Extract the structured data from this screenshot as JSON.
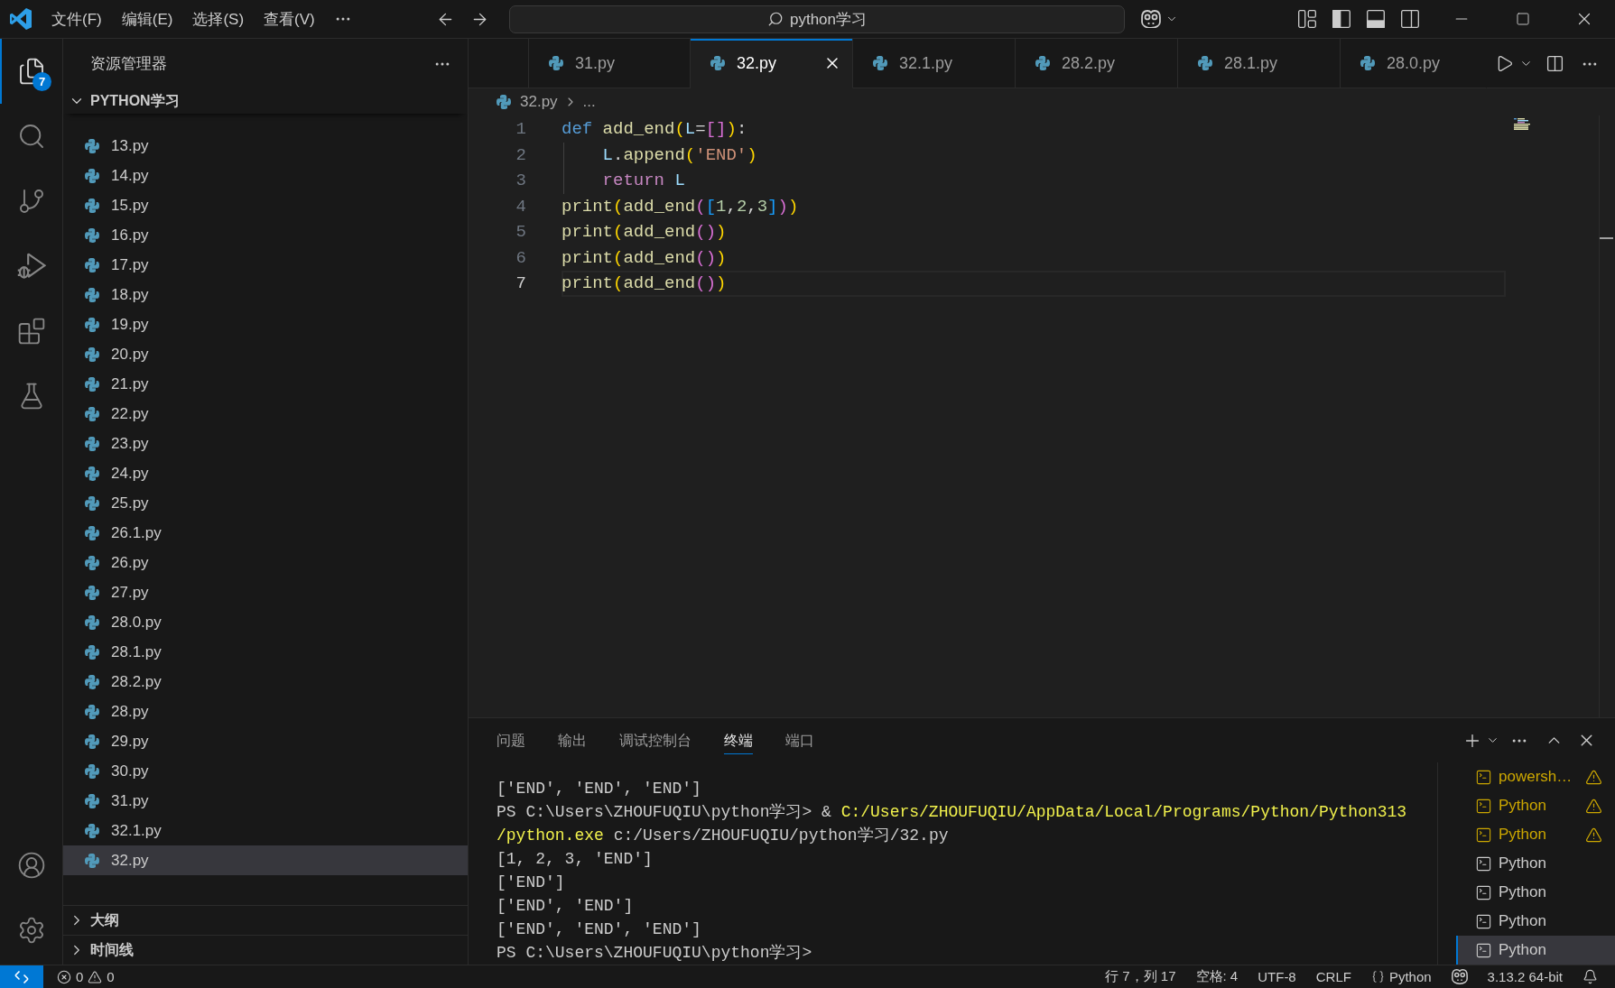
{
  "title_bar": {
    "menus": [
      "文件(F)",
      "编辑(E)",
      "选择(S)",
      "查看(V)"
    ],
    "command_center": {
      "label": "python学习"
    }
  },
  "activity_bar": {
    "items": [
      {
        "kind": "explorer",
        "selected": true,
        "badge": "7"
      },
      {
        "kind": "search",
        "selected": false
      },
      {
        "kind": "source-control",
        "selected": false
      },
      {
        "kind": "run-debug",
        "selected": false
      },
      {
        "kind": "extensions",
        "selected": false
      },
      {
        "kind": "testing",
        "selected": false
      }
    ],
    "bottom": [
      {
        "kind": "account"
      },
      {
        "kind": "settings"
      }
    ]
  },
  "sidebar": {
    "title": "资源管理器",
    "folder": {
      "name": "PYTHON学习",
      "expanded": true,
      "files": [
        {
          "name": "13.py",
          "selected": false
        },
        {
          "name": "14.py",
          "selected": false
        },
        {
          "name": "15.py",
          "selected": false
        },
        {
          "name": "16.py",
          "selected": false
        },
        {
          "name": "17.py",
          "selected": false
        },
        {
          "name": "18.py",
          "selected": false
        },
        {
          "name": "19.py",
          "selected": false
        },
        {
          "name": "20.py",
          "selected": false
        },
        {
          "name": "21.py",
          "selected": false
        },
        {
          "name": "22.py",
          "selected": false
        },
        {
          "name": "23.py",
          "selected": false
        },
        {
          "name": "24.py",
          "selected": false
        },
        {
          "name": "25.py",
          "selected": false
        },
        {
          "name": "26.1.py",
          "selected": false
        },
        {
          "name": "26.py",
          "selected": false
        },
        {
          "name": "27.py",
          "selected": false
        },
        {
          "name": "28.0.py",
          "selected": false
        },
        {
          "name": "28.1.py",
          "selected": false
        },
        {
          "name": "28.2.py",
          "selected": false
        },
        {
          "name": "28.py",
          "selected": false
        },
        {
          "name": "29.py",
          "selected": false
        },
        {
          "name": "30.py",
          "selected": false
        },
        {
          "name": "31.py",
          "selected": false
        },
        {
          "name": "32.1.py",
          "selected": false
        },
        {
          "name": "32.py",
          "selected": true
        }
      ]
    },
    "sections": [
      {
        "name": "大纲",
        "expanded": false
      },
      {
        "name": "时间线",
        "expanded": false
      }
    ]
  },
  "editor": {
    "tabs": [
      {
        "label": "31.py",
        "selected": false
      },
      {
        "label": "32.py",
        "selected": true
      },
      {
        "label": "32.1.py",
        "selected": false
      },
      {
        "label": "28.2.py",
        "selected": false
      },
      {
        "label": "28.1.py",
        "selected": false
      },
      {
        "label": "28.0.py",
        "selected": false
      }
    ],
    "breadcrumb": [
      "32.py",
      "..."
    ],
    "lines": [
      {
        "number": "1",
        "current": false,
        "tokens": [
          {
            "text": "def ",
            "kind": "keyword"
          },
          {
            "text": "add_end",
            "kind": "function"
          },
          {
            "text": "(",
            "kind": "bracket-1"
          },
          {
            "text": "L",
            "kind": "variable"
          },
          {
            "text": "=",
            "kind": "operator"
          },
          {
            "text": "[]",
            "kind": "bracket-2"
          },
          {
            "text": ")",
            "kind": "bracket-1"
          },
          {
            "text": ":",
            "kind": "operator"
          }
        ],
        "children": [
          {
            "number": "2",
            "current": false,
            "tokens": [
              {
                "text": "L",
                "kind": "variable"
              },
              {
                "text": ".",
                "kind": "operator"
              },
              {
                "text": "append",
                "kind": "function"
              },
              {
                "text": "(",
                "kind": "bracket-1"
              },
              {
                "text": "'END'",
                "kind": "string"
              },
              {
                "text": ")",
                "kind": "bracket-1"
              }
            ]
          },
          {
            "number": "3",
            "current": false,
            "tokens": [
              {
                "text": "return ",
                "kind": "control"
              },
              {
                "text": "L",
                "kind": "variable"
              }
            ]
          }
        ]
      },
      {
        "number": "4",
        "current": false,
        "tokens": [
          {
            "text": "print",
            "kind": "function"
          },
          {
            "text": "(",
            "kind": "bracket-1"
          },
          {
            "text": "add_end",
            "kind": "function"
          },
          {
            "text": "(",
            "kind": "bracket-2"
          },
          {
            "text": "[",
            "kind": "bracket-3"
          },
          {
            "text": "1",
            "kind": "number"
          },
          {
            "text": ",",
            "kind": "operator"
          },
          {
            "text": "2",
            "kind": "number"
          },
          {
            "text": ",",
            "kind": "operator"
          },
          {
            "text": "3",
            "kind": "number"
          },
          {
            "text": "]",
            "kind": "bracket-3"
          },
          {
            "text": ")",
            "kind": "bracket-2"
          },
          {
            "text": ")",
            "kind": "bracket-1"
          }
        ]
      },
      {
        "number": "5",
        "current": false,
        "tokens": [
          {
            "text": "print",
            "kind": "function"
          },
          {
            "text": "(",
            "kind": "bracket-1"
          },
          {
            "text": "add_end",
            "kind": "function"
          },
          {
            "text": "()",
            "kind": "bracket-2"
          },
          {
            "text": ")",
            "kind": "bracket-1"
          }
        ]
      },
      {
        "number": "6",
        "current": false,
        "tokens": [
          {
            "text": "print",
            "kind": "function"
          },
          {
            "text": "(",
            "kind": "bracket-1"
          },
          {
            "text": "add_end",
            "kind": "function"
          },
          {
            "text": "()",
            "kind": "bracket-2"
          },
          {
            "text": ")",
            "kind": "bracket-1"
          }
        ]
      },
      {
        "number": "7",
        "current": true,
        "tokens": [
          {
            "text": "print",
            "kind": "function"
          },
          {
            "text": "(",
            "kind": "bracket-1"
          },
          {
            "text": "add_end",
            "kind": "function"
          },
          {
            "text": "()",
            "kind": "bracket-2"
          },
          {
            "text": ")",
            "kind": "bracket-1"
          }
        ]
      }
    ]
  },
  "panel": {
    "tabs": [
      {
        "label": "问题",
        "selected": false
      },
      {
        "label": "输出",
        "selected": false
      },
      {
        "label": "调试控制台",
        "selected": false
      },
      {
        "label": "终端",
        "selected": true
      },
      {
        "label": "端口",
        "selected": false
      }
    ],
    "terminal_lines": [
      {
        "segments": [
          {
            "text": "['END', 'END', 'END']",
            "kind": "output"
          }
        ]
      },
      {
        "segments": [
          {
            "text": "PS C:\\Users\\ZHOUFUQIU\\python学习> & ",
            "kind": "output"
          },
          {
            "text": "C:/Users/ZHOUFUQIU/AppData/Local/Programs/Python/Python313",
            "kind": "command"
          }
        ]
      },
      {
        "segments": [
          {
            "text": "/python.exe",
            "kind": "command"
          },
          {
            "text": " c:/Users/ZHOUFUQIU/python学习/32.py",
            "kind": "output"
          }
        ]
      },
      {
        "segments": [
          {
            "text": "[1, 2, 3, 'END']",
            "kind": "output"
          }
        ]
      },
      {
        "segments": [
          {
            "text": "['END']",
            "kind": "output"
          }
        ]
      },
      {
        "segments": [
          {
            "text": "['END', 'END']",
            "kind": "output"
          }
        ]
      },
      {
        "segments": [
          {
            "text": "['END', 'END', 'END']",
            "kind": "output"
          }
        ]
      },
      {
        "segments": [
          {
            "text": "PS C:\\Users\\ZHOUFUQIU\\python学习>",
            "kind": "output"
          }
        ]
      }
    ],
    "terminals": [
      {
        "label": "powersh…",
        "warning": true,
        "selected": false
      },
      {
        "label": "Python",
        "warning": true,
        "selected": false
      },
      {
        "label": "Python",
        "warning": true,
        "selected": false
      },
      {
        "label": "Python",
        "warning": false,
        "selected": false
      },
      {
        "label": "Python",
        "warning": false,
        "selected": false
      },
      {
        "label": "Python",
        "warning": false,
        "selected": false
      },
      {
        "label": "Python",
        "warning": false,
        "selected": true
      }
    ]
  },
  "status_bar": {
    "errors": "0",
    "warnings": "0",
    "items": [
      {
        "kind": "text",
        "label": "行 7，列 17"
      },
      {
        "kind": "text",
        "label": "空格: 4"
      },
      {
        "kind": "text",
        "label": "UTF-8"
      },
      {
        "kind": "text",
        "label": "CRLF"
      },
      {
        "kind": "language",
        "label": "Python"
      },
      {
        "kind": "copilot"
      },
      {
        "kind": "text",
        "label": "3.13.2 64-bit"
      },
      {
        "kind": "notifications"
      }
    ]
  }
}
